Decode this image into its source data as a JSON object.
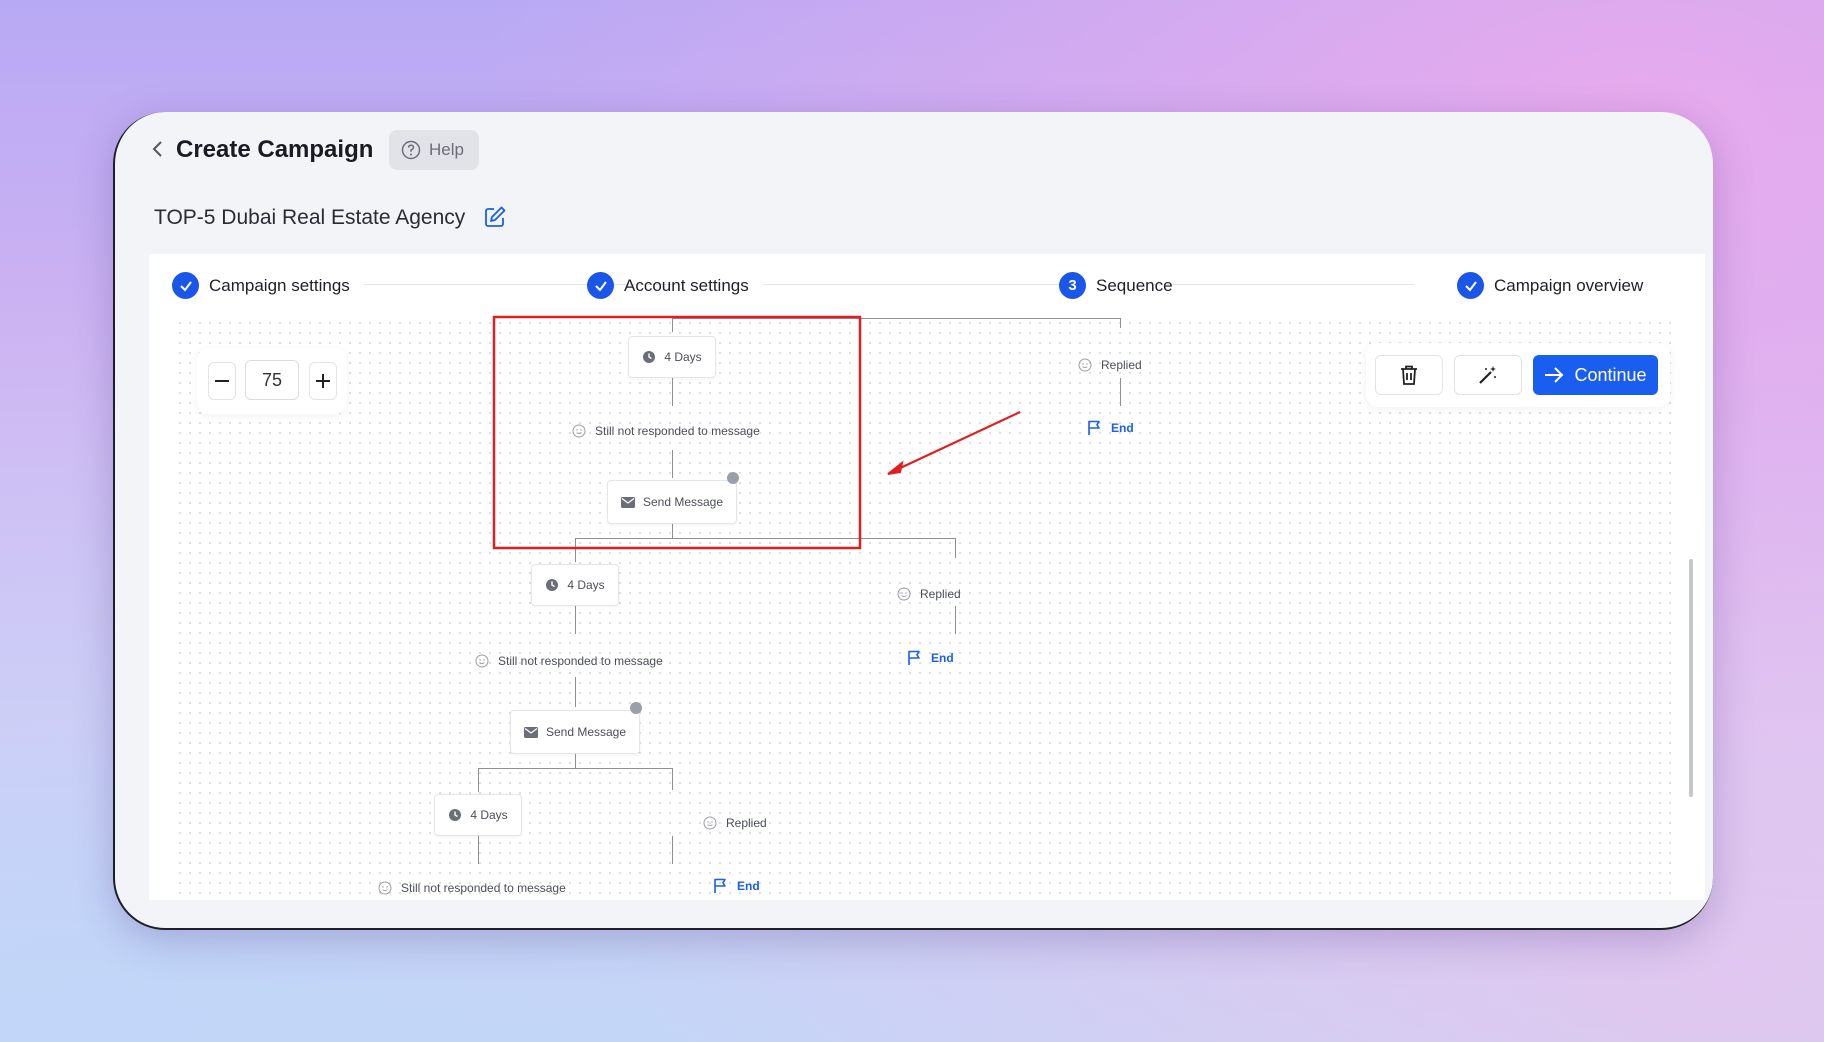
{
  "header": {
    "title": "Create Campaign",
    "help_label": "Help",
    "campaign_name": "TOP-5 Dubai Real Estate Agency"
  },
  "steps": [
    {
      "label": "Campaign settings",
      "state": "done",
      "badge": ""
    },
    {
      "label": "Account settings",
      "state": "done",
      "badge": ""
    },
    {
      "label": "Sequence",
      "state": "current",
      "badge": "3"
    },
    {
      "label": "Campaign overview",
      "state": "done",
      "badge": ""
    }
  ],
  "zoom": {
    "value": "75"
  },
  "actions": {
    "continue_label": "Continue"
  },
  "flow": {
    "delay_label": "4 Days",
    "no_reply_label": "Still not responded to message",
    "send_label": "Send Message",
    "replied_label": "Replied",
    "end_label": "End"
  },
  "colors": {
    "accent": "#1a5ef0",
    "annotation": "#e02020"
  }
}
